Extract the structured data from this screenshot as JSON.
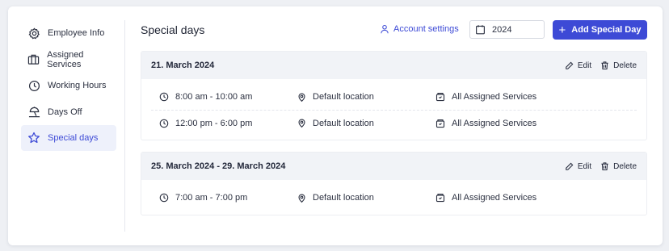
{
  "sidebar": {
    "items": [
      {
        "label": "Employee Info",
        "icon": "gear-icon"
      },
      {
        "label": "Assigned Services",
        "icon": "briefcase-icon"
      },
      {
        "label": "Working Hours",
        "icon": "clock-icon"
      },
      {
        "label": "Days Off",
        "icon": "umbrella-beach-icon"
      },
      {
        "label": "Special days",
        "icon": "star-icon",
        "active": true
      }
    ]
  },
  "header": {
    "title": "Special days",
    "account_link": "Account settings",
    "year": "2024",
    "add_button": "Add Special Day"
  },
  "colors": {
    "accent": "#3d4ad6",
    "card_header_bg": "#f1f3f7"
  },
  "special_days": [
    {
      "date": "21. March 2024",
      "edit_label": "Edit",
      "delete_label": "Delete",
      "periods": [
        {
          "time": "8:00 am - 10:00 am",
          "location": "Default location",
          "services": "All Assigned Services"
        },
        {
          "time": "12:00 pm - 6:00 pm",
          "location": "Default location",
          "services": "All Assigned Services"
        }
      ]
    },
    {
      "date": "25. March 2024 - 29. March 2024",
      "edit_label": "Edit",
      "delete_label": "Delete",
      "periods": [
        {
          "time": "7:00 am - 7:00 pm",
          "location": "Default location",
          "services": "All Assigned Services"
        }
      ]
    }
  ]
}
